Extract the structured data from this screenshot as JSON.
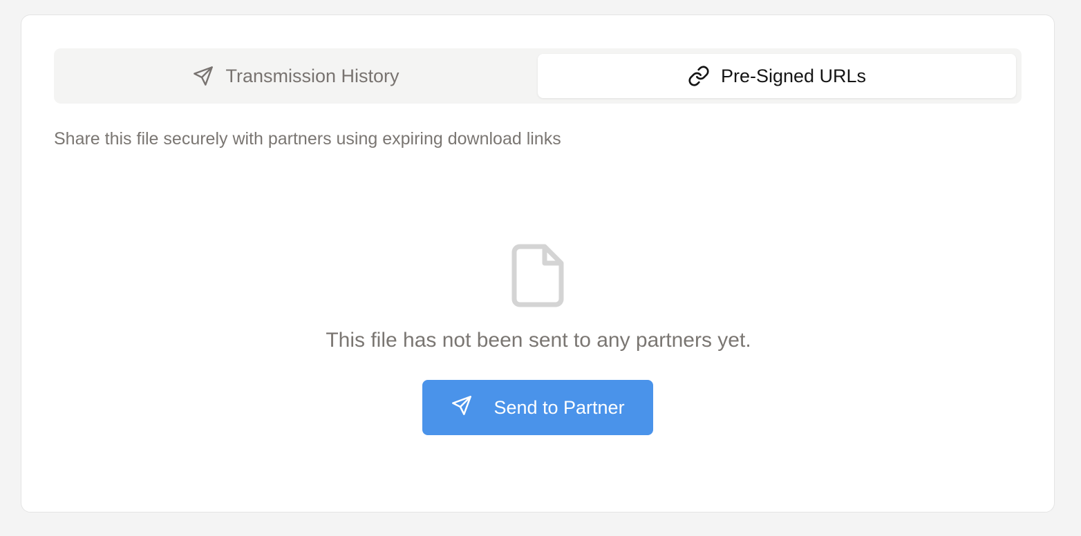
{
  "tabs": {
    "history": {
      "label": "Transmission History",
      "icon": "send-icon"
    },
    "urls": {
      "label": "Pre-Signed URLs",
      "icon": "link-icon",
      "active": true
    }
  },
  "subtitle": "Share this file securely with partners using expiring download links",
  "empty_state": {
    "icon": "file-icon",
    "message": "This file has not been sent to any partners yet.",
    "button_label": "Send to Partner",
    "button_icon": "send-icon"
  },
  "colors": {
    "accent": "#4a93ea",
    "muted_text": "#7a7672",
    "tab_bar_bg": "#f4f4f3",
    "page_bg": "#f4f4f4"
  }
}
